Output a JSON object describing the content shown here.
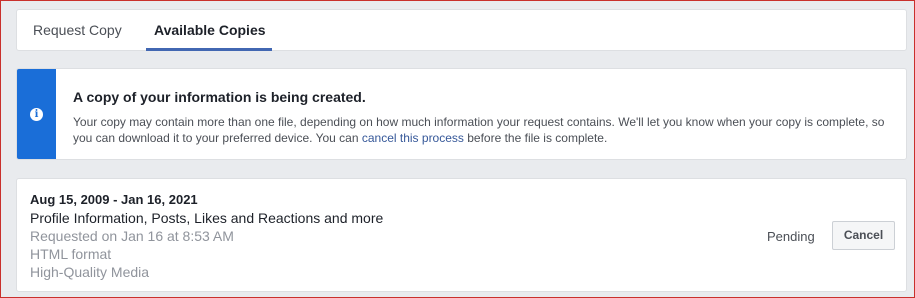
{
  "tabs": [
    {
      "label": "Request Copy"
    },
    {
      "label": "Available Copies"
    }
  ],
  "colors": {
    "accent": "#4267b2",
    "info_bar": "#1a6ed8",
    "link": "#365899"
  },
  "notice": {
    "icon": "info-icon",
    "title": "A copy of your information is being created.",
    "body_before": "Your copy may contain more than one file, depending on how much information your request contains. We'll let you know when your copy is complete, so you can download it to your preferred device. You can ",
    "link_text": "cancel this process",
    "body_after": " before the file is complete."
  },
  "copy": {
    "date_range": "Aug 15, 2009 - Jan 16, 2021",
    "description": "Profile Information, Posts, Likes and Reactions and more",
    "requested": "Requested on Jan 16 at 8:53 AM",
    "format": "HTML format",
    "media_quality": "High-Quality Media",
    "status": "Pending",
    "cancel_label": "Cancel"
  }
}
